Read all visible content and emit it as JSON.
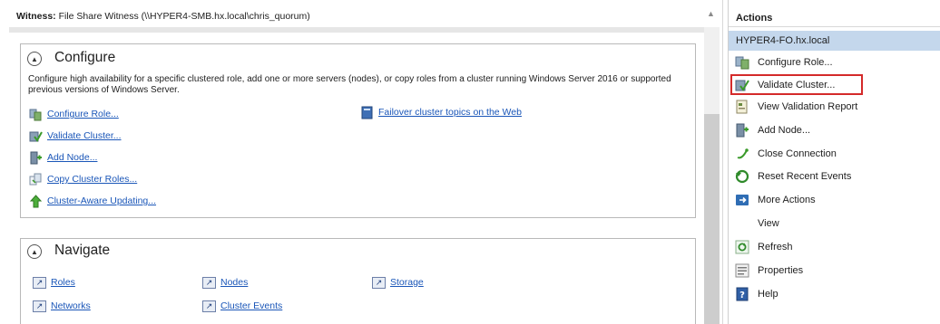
{
  "witness": {
    "label": "Witness:",
    "value": "File Share Witness (\\\\HYPER4-SMB.hx.local\\chris_quorum)"
  },
  "configure": {
    "title": "Configure",
    "description": "Configure high availability for a specific clustered role, add one or more servers (nodes), or copy roles from a cluster running Windows Server 2016 or supported previous versions of Windows Server.",
    "links": [
      {
        "label": "Configure Role...",
        "icon": "configure-role-icon"
      },
      {
        "label": "Validate Cluster...",
        "icon": "validate-cluster-icon"
      },
      {
        "label": "Add Node...",
        "icon": "add-node-icon"
      },
      {
        "label": "Copy Cluster Roles...",
        "icon": "copy-cluster-roles-icon"
      },
      {
        "label": "Cluster-Aware Updating...",
        "icon": "cluster-aware-updating-icon"
      }
    ],
    "web_link": {
      "label": "Failover cluster topics on the Web",
      "icon": "help-book-icon"
    }
  },
  "navigate": {
    "title": "Navigate",
    "links": [
      {
        "label": "Roles",
        "icon": "shortcut-icon"
      },
      {
        "label": "Nodes",
        "icon": "shortcut-icon"
      },
      {
        "label": "Storage",
        "icon": "shortcut-icon"
      },
      {
        "label": "Networks",
        "icon": "shortcut-icon"
      },
      {
        "label": "Cluster Events",
        "icon": "shortcut-icon"
      }
    ]
  },
  "actions": {
    "header": "Actions",
    "cluster": "HYPER4-FO.hx.local",
    "items": [
      {
        "label": "Configure Role...",
        "icon": "configure-role-icon"
      },
      {
        "label": "Validate Cluster...",
        "icon": "validate-cluster-icon",
        "highlighted": true
      },
      {
        "label": "View Validation Report",
        "icon": "report-icon"
      },
      {
        "label": "Add Node...",
        "icon": "add-node-icon"
      },
      {
        "label": "Close Connection",
        "icon": "close-connection-icon"
      },
      {
        "label": "Reset Recent Events",
        "icon": "reset-events-icon"
      },
      {
        "label": "More Actions",
        "icon": "more-actions-icon"
      },
      {
        "label": "View",
        "icon": ""
      },
      {
        "label": "Refresh",
        "icon": "refresh-icon"
      },
      {
        "label": "Properties",
        "icon": "properties-icon"
      },
      {
        "label": "Help",
        "icon": "help-icon"
      }
    ]
  },
  "colors": {
    "link": "#1a56b8",
    "cluster_header_bg": "#c4d7ec",
    "highlight_border": "#d42a2a"
  }
}
